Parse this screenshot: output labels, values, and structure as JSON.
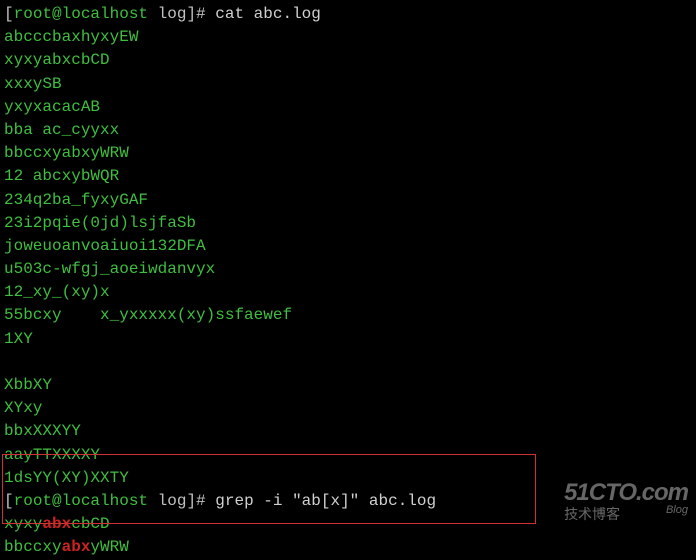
{
  "prompt": {
    "open": "[",
    "user_host": "root@localhost",
    "path": " log",
    "close": "]",
    "symbol": "#"
  },
  "cmd1": " cat abc.log",
  "cat_output": [
    "abcccbaxhyxyEW",
    "xyxyabxcbCD",
    "xxxySB",
    "yxyxacacAB",
    "bba ac_cyyxx",
    "bbccxyabxyWRW",
    "12 abcxybWQR",
    "234q2ba_fyxyGAF",
    "23i2pqie(0jd)lsjfaSb",
    "joweuoanvoaiuoi132DFA",
    "u503c-wfgj_aoeiwdanvyx",
    "12_xy_(xy)x",
    "55bcxy    x_yxxxxx(xy)ssfaewef",
    "1XY",
    "",
    "XbbXY",
    "XYxy",
    "bbxXXXYY",
    "aayTTXXXXY",
    "1dsYY(XY)XXTY"
  ],
  "cmd2": " grep -i \"ab[x]\" abc.log",
  "grep_output": [
    {
      "pre": "xyxy",
      "match": "abx",
      "post": "cbCD"
    },
    {
      "pre": "bbccxy",
      "match": "abx",
      "post": "yWRW"
    }
  ],
  "watermark": {
    "line1": "51CTO.com",
    "line2": "技术博客",
    "blog": "Blog"
  }
}
